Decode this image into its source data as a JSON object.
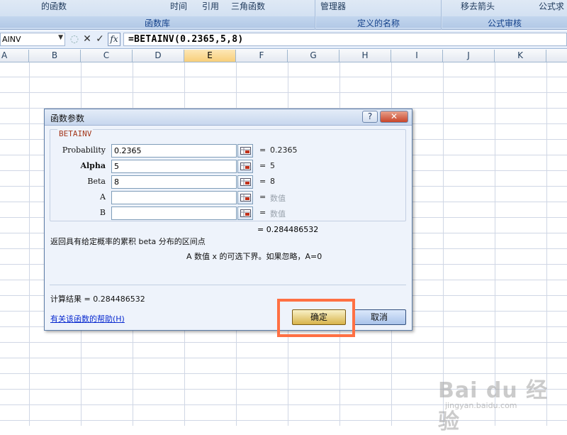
{
  "ribbon": {
    "group1": {
      "items": [
        "的函数",
        "时间",
        "引用",
        "三角函数"
      ],
      "title": "函数库"
    },
    "group2": {
      "items": [
        "管理器"
      ],
      "title": "定义的名称"
    },
    "group3": {
      "items": [
        "移去箭头",
        "公式求"
      ],
      "title": "公式审核"
    }
  },
  "formula_bar": {
    "name_box": "AINV",
    "cancel_symbol": "✕",
    "enter_symbol": "✓",
    "fx_label": "fx",
    "formula": "=BETAINV(0.2365,5,8)"
  },
  "sheet": {
    "columns": [
      "A",
      "B",
      "C",
      "D",
      "E",
      "F",
      "G",
      "H",
      "I",
      "J",
      "K"
    ],
    "selected_column": "E"
  },
  "dialog": {
    "title": "函数参数",
    "help_button": "?",
    "close_button": "✕",
    "function_name": "BETAINV",
    "args": [
      {
        "label": "Probability",
        "value": "0.2365",
        "eq": "=",
        "result": "0.2365"
      },
      {
        "label": "Alpha",
        "value": "5",
        "eq": "=",
        "result": "5"
      },
      {
        "label": "Beta",
        "value": "8",
        "eq": "=",
        "result": "8"
      },
      {
        "label": "A",
        "value": "",
        "eq": "=",
        "result": "数值"
      },
      {
        "label": "B",
        "value": "",
        "eq": "=",
        "result": "数值"
      }
    ],
    "result_line": "= 0.284486532",
    "description": "返回具有给定概率的累积 beta 分布的区间点",
    "arg_description": "A 数值 x 的可选下界。如果忽略，A=0",
    "calc_result": "计算结果 = 0.284486532",
    "help_link": "有关该函数的帮助(H)",
    "ok_button": "确定",
    "cancel_button": "取消"
  },
  "watermark": {
    "logo": "Bai du 经验",
    "url": "jingyan.baidu.com"
  },
  "colors": {
    "highlight_border": "#ff7043",
    "ribbon_title": "#15428b",
    "link": "#0a2bd0"
  },
  "icons": [
    "range-reference-icon",
    "help-icon",
    "close-icon",
    "fx-icon",
    "cancel-icon",
    "enter-icon"
  ]
}
